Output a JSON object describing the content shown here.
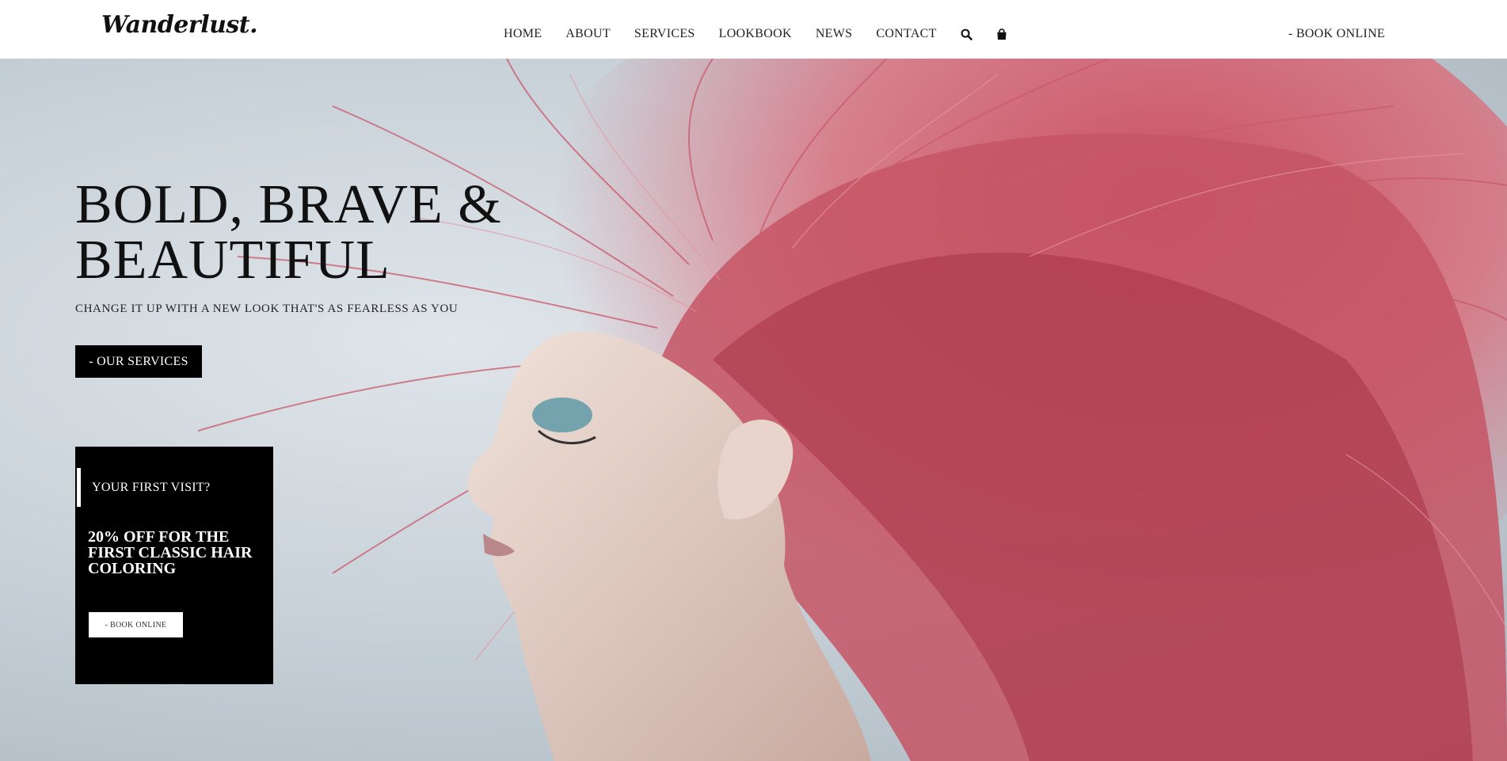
{
  "header": {
    "logo": "Wanderlust.",
    "nav": [
      {
        "label": "HOME"
      },
      {
        "label": "ABOUT"
      },
      {
        "label": "SERVICES"
      },
      {
        "label": "LOOKBOOK"
      },
      {
        "label": "NEWS"
      },
      {
        "label": "CONTACT"
      }
    ],
    "icons": [
      "search-icon",
      "shopping-bag-icon"
    ],
    "book_online": "- BOOK ONLINE"
  },
  "hero": {
    "title_line1": "BOLD, BRAVE &",
    "title_line2": "BEAUTIFUL",
    "subtitle": "CHANGE IT UP WITH A NEW LOOK THAT'S AS FEARLESS AS YOU",
    "cta": "- OUR SERVICES"
  },
  "promo": {
    "kicker": "YOUR FIRST VISIT?",
    "offer": "20% OFF FOR THE FIRST CLASSIC HAIR COLORING",
    "cta": "- BOOK ONLINE"
  },
  "colors": {
    "accent": "#000000",
    "hair": "#d9576a",
    "background": "#c9d2d9"
  }
}
